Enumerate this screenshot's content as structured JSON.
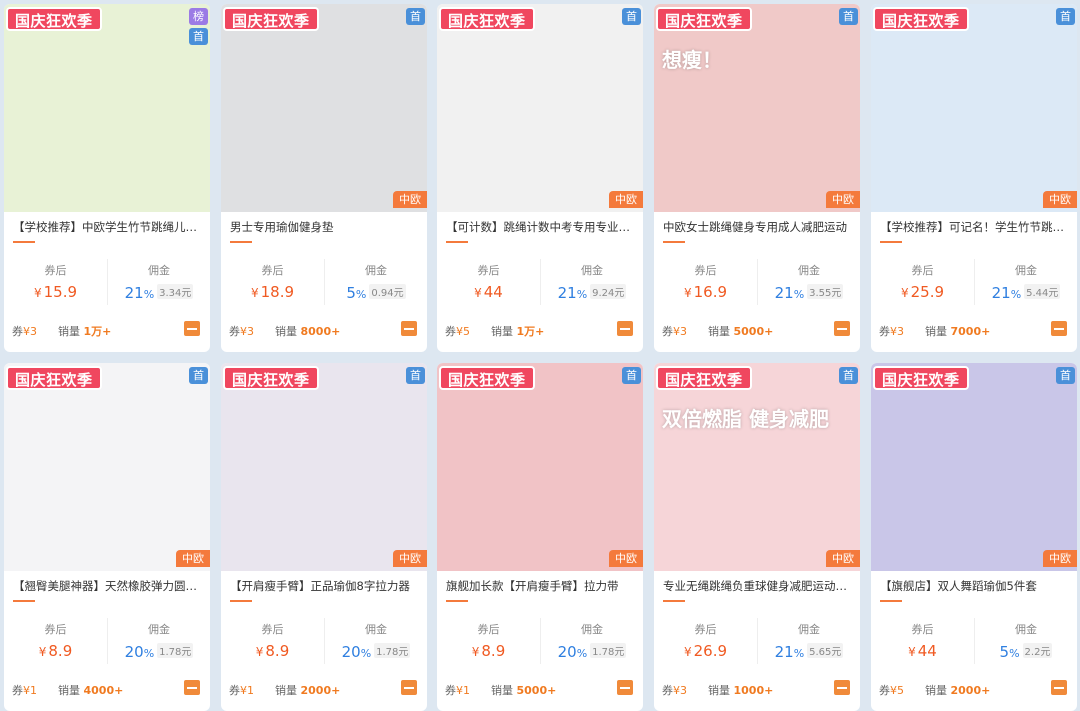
{
  "ui": {
    "promo": "国庆狂欢季",
    "first": "首",
    "rank": "榜",
    "brand": "中欧",
    "coupon_label": "券后",
    "commission_label": "佣金",
    "coupon_prefix": "券",
    "sales_prefix": "销量",
    "currency": "¥",
    "amount_suffix": "元"
  },
  "products": [
    {
      "title": "【学校推荐】中欧学生竹节跳绳儿童…",
      "price": "15.9",
      "pct": "21",
      "amt": "3.34",
      "coupon": "¥3",
      "sales": "1万+",
      "promo": true,
      "rank": true,
      "first": true,
      "brand": false,
      "bg": "#e8f2d6",
      "image_text": ""
    },
    {
      "title": "男士专用瑜伽健身垫",
      "price": "18.9",
      "pct": "5",
      "amt": "0.94",
      "coupon": "¥3",
      "sales": "8000+",
      "promo": true,
      "rank": false,
      "first": true,
      "brand": true,
      "bg": "#dfe0e2",
      "image_text": ""
    },
    {
      "title": "【可计数】跳绳计数中考专用专业跳绳",
      "price": "44",
      "pct": "21",
      "amt": "9.24",
      "coupon": "¥5",
      "sales": "1万+",
      "promo": true,
      "rank": false,
      "first": true,
      "brand": true,
      "bg": "#f1f1f1",
      "image_text": ""
    },
    {
      "title": "中欧女士跳绳健身专用成人减肥运动",
      "price": "16.9",
      "pct": "21",
      "amt": "3.55",
      "coupon": "¥3",
      "sales": "5000+",
      "promo": true,
      "rank": false,
      "first": true,
      "brand": true,
      "bg": "#f0c9c8",
      "image_text": "想瘦！"
    },
    {
      "title": "【学校推荐】可记名！学生竹节跳绳…",
      "price": "25.9",
      "pct": "21",
      "amt": "5.44",
      "coupon": "¥3",
      "sales": "7000+",
      "promo": true,
      "rank": false,
      "first": true,
      "brand": true,
      "bg": "#dce9f6",
      "image_text": ""
    },
    {
      "title": "【翘臀美腿神器】天然橡胶弹力圆拉…",
      "price": "8.9",
      "pct": "20",
      "amt": "1.78",
      "coupon": "¥1",
      "sales": "4000+",
      "promo": true,
      "rank": false,
      "first": true,
      "brand": true,
      "bg": "#f4f4f6",
      "image_text": ""
    },
    {
      "title": "【开肩瘦手臂】正品瑜伽8字拉力器",
      "price": "8.9",
      "pct": "20",
      "amt": "1.78",
      "coupon": "¥1",
      "sales": "2000+",
      "promo": true,
      "rank": false,
      "first": true,
      "brand": true,
      "bg": "#e9e5ee",
      "image_text": ""
    },
    {
      "title": "旗舰加长款【开肩瘦手臂】拉力带",
      "price": "8.9",
      "pct": "20",
      "amt": "1.78",
      "coupon": "¥1",
      "sales": "5000+",
      "promo": true,
      "rank": false,
      "first": true,
      "brand": true,
      "bg": "#f1c3c6",
      "image_text": ""
    },
    {
      "title": "专业无绳跳绳负重球健身减肥运动负…",
      "price": "26.9",
      "pct": "21",
      "amt": "5.65",
      "coupon": "¥3",
      "sales": "1000+",
      "promo": true,
      "rank": false,
      "first": true,
      "brand": true,
      "bg": "#f6d5d8",
      "image_text": "双倍燃脂 健身减肥"
    },
    {
      "title": "【旗舰店】双人舞蹈瑜伽5件套",
      "price": "44",
      "pct": "5",
      "amt": "2.2",
      "coupon": "¥5",
      "sales": "2000+",
      "promo": true,
      "rank": false,
      "first": true,
      "brand": true,
      "bg": "#c9c6e8",
      "image_text": ""
    }
  ]
}
